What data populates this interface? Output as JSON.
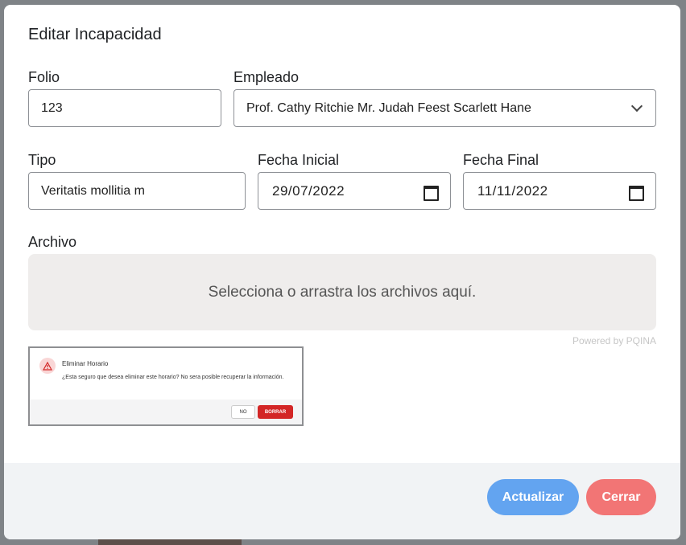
{
  "modal": {
    "title": "Editar Incapacidad"
  },
  "form": {
    "folio": {
      "label": "Folio",
      "value": "123"
    },
    "empleado": {
      "label": "Empleado",
      "selected": "Prof. Cathy Ritchie Mr. Judah Feest Scarlett Hane"
    },
    "tipo": {
      "label": "Tipo",
      "value": "Veritatis mollitia m"
    },
    "fecha_inicial": {
      "label": "Fecha Inicial",
      "value": "29/07/2022"
    },
    "fecha_final": {
      "label": "Fecha Final",
      "value": "11/11/2022"
    },
    "archivo": {
      "label": "Archivo"
    }
  },
  "dropzone": {
    "text": "Selecciona o arrastra los archivos aquí.",
    "powered_by": "Powered by PQINA"
  },
  "thumbnail": {
    "title": "Eliminar Horario",
    "message": "¿Esta seguro que desea eliminar este horario? No sera posible recuperar la información.",
    "no_label": "NO",
    "borrar_label": "BORRAR"
  },
  "footer": {
    "update_label": "Actualizar",
    "close_label": "Cerrar"
  },
  "colors": {
    "primary": "#63a4f0",
    "danger": "#f27575",
    "dropzone_bg": "#efedec"
  }
}
